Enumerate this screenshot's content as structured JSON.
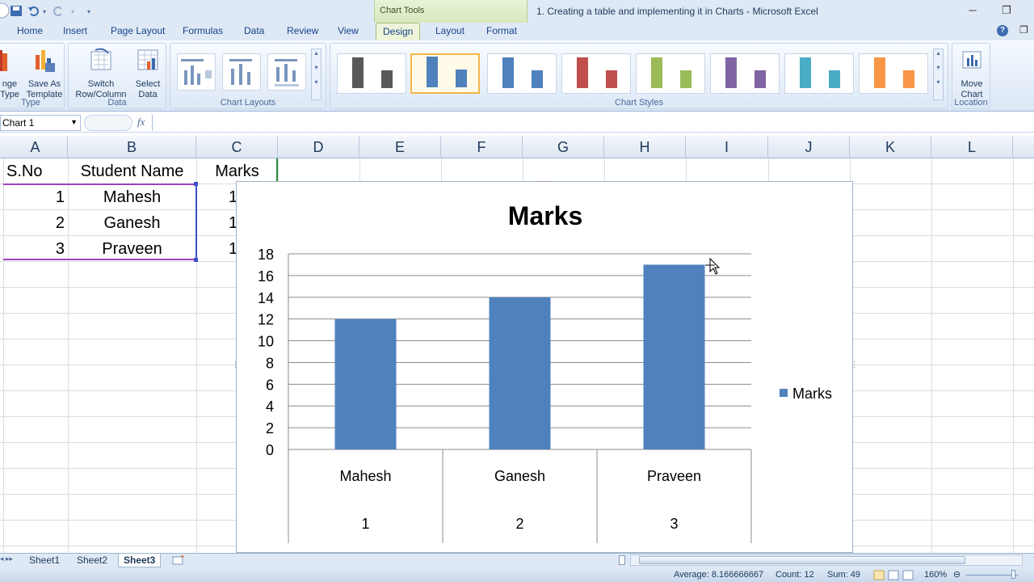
{
  "window": {
    "title": "1. Creating a table and implementing it in Charts - Microsoft Excel",
    "context_tab": "Chart Tools",
    "minimize": "─",
    "restore": "❐",
    "help": "?",
    "doc_restore": "❐"
  },
  "tabs": [
    "Home",
    "Insert",
    "Page Layout",
    "Formulas",
    "Data",
    "Review",
    "View",
    "Design",
    "Layout",
    "Format"
  ],
  "active_tab": "Design",
  "ribbon": {
    "type_group": {
      "label": "Type",
      "btn1_l1": "nge",
      "btn1_l2": "Type",
      "btn2_l1": "Save As",
      "btn2_l2": "Template"
    },
    "data_group": {
      "label": "Data",
      "switch_l1": "Switch",
      "switch_l2": "Row/Column",
      "select_l1": "Select",
      "select_l2": "Data"
    },
    "layouts_group": {
      "label": "Chart Layouts"
    },
    "styles_group": {
      "label": "Chart Styles"
    },
    "location_group": {
      "label": "Location",
      "move_l1": "Move",
      "move_l2": "Chart"
    },
    "style_colors": [
      "#595959",
      "#4f81bd",
      "#4f81bd",
      "#c0504d",
      "#9bbb59",
      "#8064a2",
      "#4bacc6",
      "#f79646"
    ]
  },
  "formula_bar": {
    "name_box": "Chart 1",
    "fx": "fx",
    "content": ""
  },
  "columns": [
    "A",
    "B",
    "C",
    "D",
    "E",
    "F",
    "G",
    "H",
    "I",
    "J",
    "K",
    "L"
  ],
  "table": {
    "headers": [
      "S.No",
      "Student Name",
      "Marks"
    ],
    "rows": [
      {
        "sno": "1",
        "name": "Mahesh",
        "marks": "1"
      },
      {
        "sno": "2",
        "name": "Ganesh",
        "marks": "1"
      },
      {
        "sno": "3",
        "name": "Praveen",
        "marks": "1"
      }
    ]
  },
  "chart_data": {
    "type": "bar",
    "title": "Marks",
    "categories": [
      "Mahesh",
      "Ganesh",
      "Praveen"
    ],
    "category_numbers": [
      "1",
      "2",
      "3"
    ],
    "series": [
      {
        "name": "Marks",
        "values": [
          12,
          14,
          17
        ],
        "color": "#4f81bd"
      }
    ],
    "ylim": [
      0,
      18
    ],
    "yticks": [
      0,
      2,
      4,
      6,
      8,
      10,
      12,
      14,
      16,
      18
    ],
    "grid": true,
    "legend": "right"
  },
  "sheets": [
    "Sheet1",
    "Sheet2",
    "Sheet3"
  ],
  "active_sheet": "Sheet3",
  "status": {
    "average": "Average: 8.166666667",
    "count": "Count: 12",
    "sum": "Sum: 49",
    "zoom": "160%"
  }
}
